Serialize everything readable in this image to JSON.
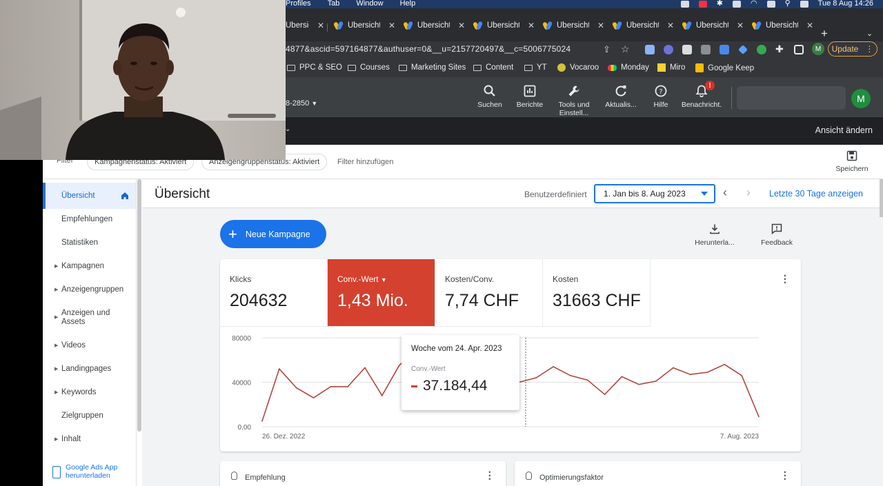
{
  "menubar": {
    "items": [
      "Profiles",
      "Tab",
      "Window",
      "Help"
    ],
    "datetime": "Tue 8 Aug  14:26"
  },
  "tabs": [
    "Übersicht",
    "Übersicht",
    "Übersicht",
    "Übersicht",
    "Übersicht",
    "Übersicht",
    "Übersicht",
    "Übersicht"
  ],
  "browser": {
    "url": "4877&ascid=597164877&authuser=0&__u=2157720497&__c=5006775024",
    "update_label": "Update",
    "profile_initial": "M"
  },
  "bookmarks": [
    "PPC & SEO",
    "Courses",
    "Marketing Sites",
    "Content",
    "YT",
    "Vocaroo",
    "Monday",
    "Miro",
    "Google Keep"
  ],
  "header": {
    "account_suffix": "8-2850",
    "tools": [
      "Suchen",
      "Berichte",
      "Tools und Einstell...",
      "Aktualis...",
      "Hilfe",
      "Benachricht."
    ],
    "notification_badge": "!",
    "avatar_initial": "M",
    "view_change": "Ansicht ändern"
  },
  "filters": {
    "label": "Filter",
    "chips": [
      "Kampagnenstatus: Aktiviert",
      "Anzeigengruppenstatus: Aktiviert"
    ],
    "add_filter": "Filter hinzufügen",
    "save_label": "Speichern"
  },
  "sidebar": {
    "items": [
      {
        "label": "Übersicht",
        "expandable": false,
        "active": true
      },
      {
        "label": "Empfehlungen",
        "expandable": false
      },
      {
        "label": "Statistiken",
        "expandable": false
      },
      {
        "label": "Kampagnen",
        "expandable": true
      },
      {
        "label": "Anzeigengruppen",
        "expandable": true
      },
      {
        "label": "Anzeigen und Assets",
        "expandable": true
      },
      {
        "label": "Videos",
        "expandable": true
      },
      {
        "label": "Landingpages",
        "expandable": true
      },
      {
        "label": "Keywords",
        "expandable": true
      },
      {
        "label": "Zielgruppen",
        "expandable": false
      },
      {
        "label": "Inhalt",
        "expandable": true
      }
    ],
    "app_download": "Google Ads App herunterladen"
  },
  "main": {
    "title": "Übersicht",
    "date_type": "Benutzerdefiniert",
    "date_range": "1. Jan bis 8. Aug 2023",
    "last30": "Letzte 30 Tage anzeigen",
    "new_campaign": "Neue Kampagne",
    "download_label": "Herunterla...",
    "feedback_label": "Feedback"
  },
  "metrics": [
    {
      "label": "Klicks",
      "value": "204632"
    },
    {
      "label": "Conv.-Wert",
      "value": "1,43 Mio.",
      "active": true
    },
    {
      "label": "Kosten/Conv.",
      "value": "7,74 CHF"
    },
    {
      "label": "Kosten",
      "value": "31663 CHF"
    }
  ],
  "chart_data": {
    "type": "line",
    "series": [
      {
        "name": "Conv.-Wert",
        "values": [
          5000,
          52000,
          35000,
          26000,
          36000,
          36000,
          53000,
          28000,
          55000,
          70000,
          72000,
          65000,
          55000,
          45000,
          37000,
          40000,
          44000,
          54000,
          46000,
          42000,
          29000,
          45000,
          38000,
          41000,
          53000,
          47000,
          49000,
          56000,
          46000,
          9000
        ]
      }
    ],
    "x_start": "26. Dez. 2022",
    "x_end": "7. Aug. 2023",
    "yticks": [
      "0,00",
      "40000",
      "80000"
    ],
    "ylim": [
      0,
      80000
    ],
    "color": "#b3453a",
    "grid": true,
    "tooltip": {
      "title": "Woche vom 24. Apr. 2023",
      "series": "Conv.-Wert",
      "value": "37.184,44"
    }
  },
  "bottom_cards": [
    "Empfehlung",
    "Optimierungsfaktor"
  ],
  "colors": {
    "accent": "#1a73e8",
    "metric_active": "#d5412f",
    "header_dark": "#3c4043"
  }
}
